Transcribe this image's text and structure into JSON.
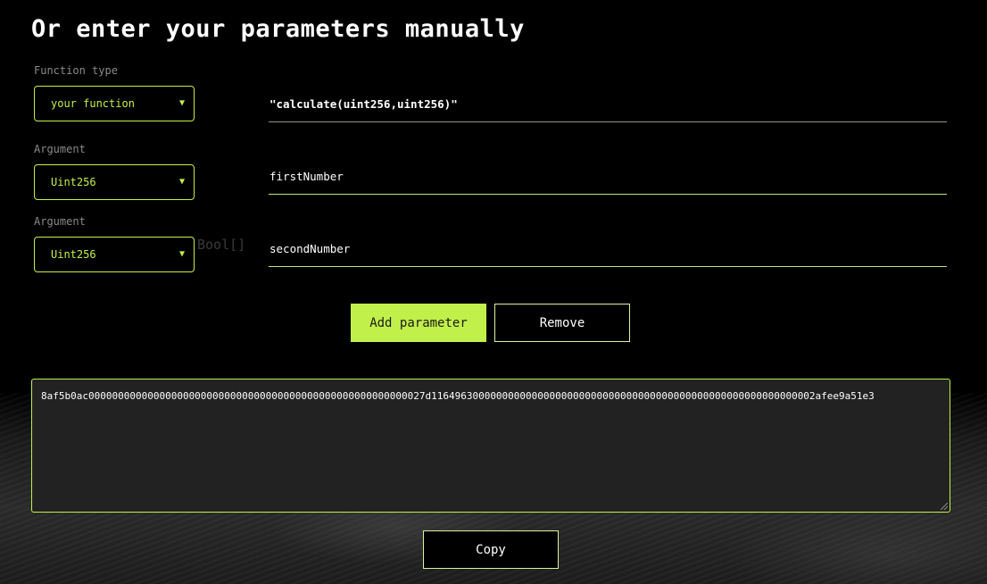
{
  "title": "Or enter your parameters manually",
  "function_type": {
    "label": "Function type",
    "selected": "your function",
    "signature": "\"calculate(uint256,uint256)\""
  },
  "arguments": [
    {
      "label": "Argument",
      "selected": "Uint256",
      "name": "firstNumber"
    },
    {
      "label": "Argument",
      "selected": "Uint256",
      "name": "secondNumber"
    }
  ],
  "ghost_option": "Bool[]",
  "buttons": {
    "add": "Add parameter",
    "remove": "Remove",
    "copy": "Copy"
  },
  "output": "8af5b0ac000000000000000000000000000000000000000000000000000000027d11649630000000000000000000000000000000000000000000000000000000002afee9a51e3",
  "colors": {
    "accent": "#c1f04a",
    "background": "#000000",
    "output_bg": "#222222"
  },
  "icons": {
    "chevron": "chevron-down-icon"
  }
}
